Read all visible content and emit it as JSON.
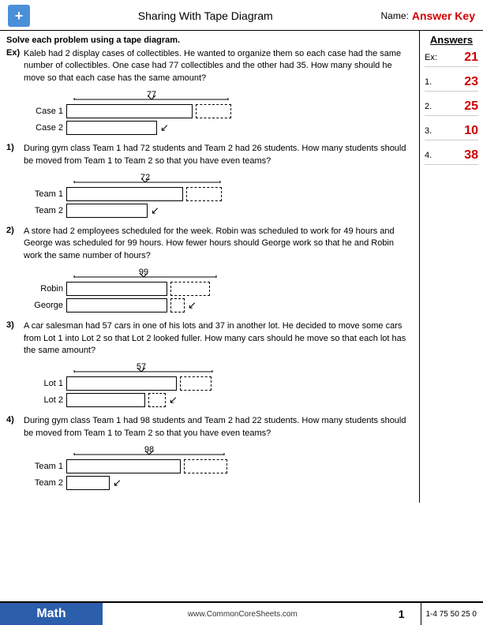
{
  "header": {
    "title": "Sharing With Tape Diagram",
    "name_label": "Name:",
    "answer_key": "Answer Key"
  },
  "instructions": "Solve each problem using a tape diagram.",
  "example": {
    "num": "Ex)",
    "text": "Kaleb had 2 display cases of collectibles. He wanted to organize them so each case had the same number of collectibles. One case had 77 collectibles and the other had 35. How many should he move so that each case has the same amount?",
    "total": "77",
    "rows": [
      {
        "label": "Case 1",
        "solid_width": 160,
        "dashed_width": 60
      },
      {
        "label": "Case 2",
        "solid_width": 80,
        "dashed_width": 0,
        "has_arrow": true
      }
    ]
  },
  "problems": [
    {
      "num": "1)",
      "text": "During gym class Team 1 had 72 students and Team 2 had 26 students. How many students should be moved from Team 1 to Team 2 so that you have even teams?",
      "total": "72",
      "rows": [
        {
          "label": "Team 1",
          "solid_width": 150,
          "dashed_width": 55
        },
        {
          "label": "Team 2",
          "solid_width": 75,
          "dashed_width": 0,
          "has_arrow": true
        }
      ]
    },
    {
      "num": "2)",
      "text": "A store had 2 employees scheduled for the week. Robin was scheduled to work for 49 hours and George was scheduled for 99 hours. How fewer hours should George work so that he and Robin work the same number of hours?",
      "total": "99",
      "rows": [
        {
          "label": "Robin",
          "solid_width": 130,
          "dashed_width": 55
        },
        {
          "label": "George",
          "solid_width": 85,
          "dashed_width": 0,
          "has_arrow": true
        }
      ]
    },
    {
      "num": "3)",
      "text": "A car salesman had 57 cars in one of his lots and 37 in another lot. He decided to move some cars from Lot 1 into Lot 2 so that Lot 2 looked fuller. How many cars should he move so that each lot has the same amount?",
      "total": "57",
      "rows": [
        {
          "label": "Lot 1",
          "solid_width": 145,
          "dashed_width": 50
        },
        {
          "label": "Lot 2",
          "solid_width": 95,
          "dashed_width": 0,
          "has_arrow": true
        }
      ]
    },
    {
      "num": "4)",
      "text": "During gym class Team 1 had 98 students and Team 2 had 22 students. How many students should be moved from Team 1 to Team 2 so that you have even teams?",
      "total": "98",
      "rows": [
        {
          "label": "Team 1",
          "solid_width": 155,
          "dashed_width": 65
        },
        {
          "label": "Team 2",
          "solid_width": 55,
          "dashed_width": 0,
          "has_arrow": true
        }
      ]
    }
  ],
  "answers": {
    "title": "Answers",
    "items": [
      {
        "label": "Ex:",
        "value": "21"
      },
      {
        "label": "1.",
        "value": "23"
      },
      {
        "label": "2.",
        "value": "25"
      },
      {
        "label": "3.",
        "value": "10"
      },
      {
        "label": "4.",
        "value": "38"
      }
    ]
  },
  "footer": {
    "subject": "Math",
    "website": "www.CommonCoreSheets.com",
    "page": "1",
    "stats": "1-4  75 50 25  0"
  }
}
